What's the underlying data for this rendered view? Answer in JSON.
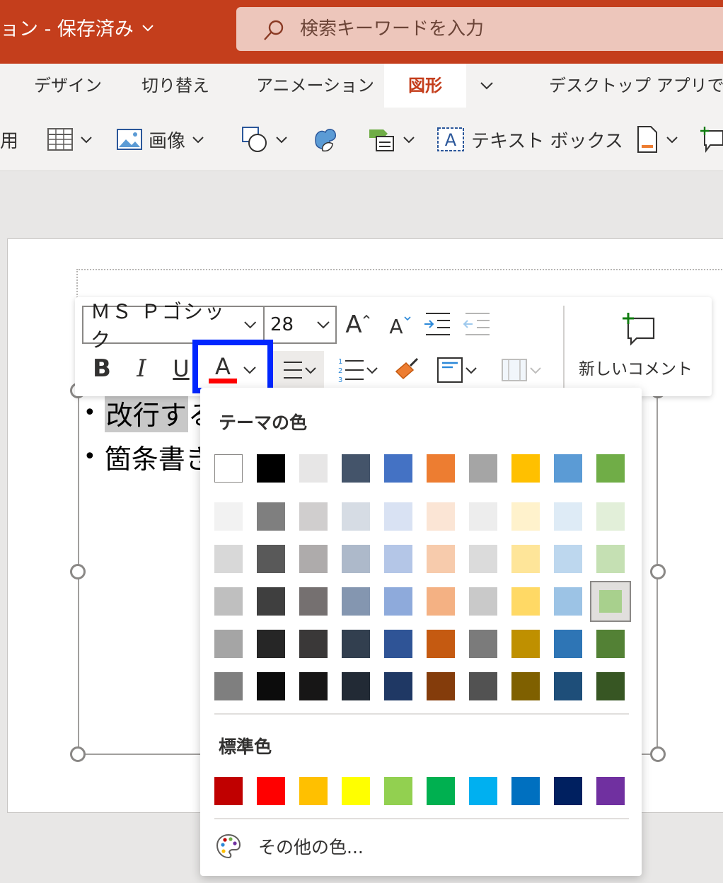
{
  "titlebar": {
    "doc_title": "ョン - 保存済み",
    "search_placeholder": "検索キーワードを入力"
  },
  "tabs": [
    {
      "label": "デザイン",
      "active": false
    },
    {
      "label": "切り替え",
      "active": false
    },
    {
      "label": "アニメーション",
      "active": false
    },
    {
      "label": "図形",
      "active": true
    },
    {
      "label": "デスクトップ アプリで開く",
      "active": false
    }
  ],
  "ribbon": {
    "partial_left": "用",
    "image_label": "画像",
    "textbox_label": "テキスト ボックス"
  },
  "slide": {
    "line1_highlighted": "改行す",
    "line1_rest": "る",
    "line2": "箇条書き"
  },
  "mini_toolbar": {
    "font_name": "ＭＳ Ｐゴシック",
    "font_size": "28",
    "bold": "B",
    "italic": "I",
    "underline": "U",
    "font_color_letter": "A",
    "font_color_value": "#ff0000",
    "grow_letter": "A",
    "shrink_letter": "A",
    "new_comment": "新しいコメント"
  },
  "color_panel": {
    "theme_heading": "テーマの色",
    "standard_heading": "標準色",
    "more_colors": "その他の色...",
    "theme_base": [
      "#ffffff",
      "#000000",
      "#e7e6e6",
      "#44546a",
      "#4472c4",
      "#ed7d31",
      "#a5a5a5",
      "#ffc000",
      "#5b9bd5",
      "#70ad47"
    ],
    "theme_shades": [
      [
        "#f2f2f2",
        "#7f7f7f",
        "#d0cece",
        "#d6dce4",
        "#d9e2f3",
        "#fbe5d5",
        "#ededed",
        "#fff2cc",
        "#deebf6",
        "#e2efd9"
      ],
      [
        "#d8d8d8",
        "#595959",
        "#aeabab",
        "#adb9ca",
        "#b4c6e7",
        "#f7cbac",
        "#dbdbdb",
        "#fee599",
        "#bdd7ee",
        "#c5e0b3"
      ],
      [
        "#bfbfbf",
        "#3f3f3f",
        "#757070",
        "#8496b0",
        "#8eaadb",
        "#f4b183",
        "#c9c9c9",
        "#ffd965",
        "#9cc3e5",
        "#a8d08d"
      ],
      [
        "#a5a5a5",
        "#262626",
        "#3a3838",
        "#323f4f",
        "#2f5496",
        "#c55a11",
        "#7b7b7b",
        "#bf9000",
        "#2e75b5",
        "#538135"
      ],
      [
        "#7f7f7f",
        "#0c0c0c",
        "#171616",
        "#222a35",
        "#1f3864",
        "#843c0b",
        "#525252",
        "#7f6000",
        "#1e4e79",
        "#375623"
      ]
    ],
    "selected_shade": {
      "row": 2,
      "col": 9
    },
    "standard_colors": [
      "#c00000",
      "#ff0000",
      "#ffc000",
      "#ffff00",
      "#92d050",
      "#00b050",
      "#00b0f0",
      "#0070c0",
      "#002060",
      "#7030a0"
    ]
  },
  "colors": {
    "brand": "#c43e1c",
    "search_bg": "#edc6bb",
    "highlight_box": "#0026ff"
  }
}
